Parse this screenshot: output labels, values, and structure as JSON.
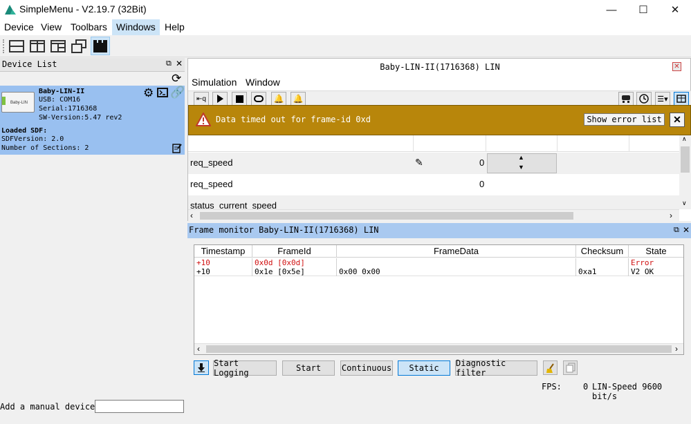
{
  "window": {
    "title": "SimpleMenu - V2.19.7 (32Bit)",
    "minimize": "—",
    "maximize": "☐",
    "close": "✕"
  },
  "menubar": [
    "Device",
    "View",
    "Toolbars",
    "Windows",
    "Help"
  ],
  "device_panel": {
    "title": "Device List",
    "device": {
      "name": "Baby-LIN-II",
      "usb": "USB: COM16",
      "serial": "Serial:1716368",
      "sw_version": "SW-Version:5.47 rev2",
      "image_label": "Baby-LIN"
    },
    "loaded_sdf_label": "Loaded SDF:",
    "sdf_version": "SDFVersion: 2.0",
    "sections": "Number of Sections: 2",
    "manual_device_label": "Add a manual device:",
    "manual_device_value": ""
  },
  "main_window": {
    "title": "Baby-LIN-II(1716368) LIN",
    "menus": [
      "Simulation",
      "Window"
    ],
    "error": {
      "message": "Data timed out for frame-id 0xd",
      "show_list_label": "Show error list",
      "close": "✕"
    },
    "signals": [
      {
        "name": "req_speed",
        "value": "0",
        "editable": true
      },
      {
        "name": "req_speed",
        "value": "0",
        "editable": false
      },
      {
        "name": "status_current_speed",
        "value": "",
        "editable": false
      }
    ]
  },
  "frame_monitor": {
    "title": "Frame monitor Baby-LIN-II(1716368) LIN",
    "columns": [
      "Timestamp",
      "FrameId",
      "FrameData",
      "Checksum",
      "State"
    ],
    "rows": [
      {
        "timestamp": "+10",
        "frame_id": "0x0d [0x0d]",
        "frame_data": "",
        "checksum": "",
        "state": "Error",
        "error": true
      },
      {
        "timestamp": "+10",
        "frame_id": "0x1e [0x5e]",
        "frame_data": "0x00 0x00",
        "checksum": "0xa1",
        "state": "V2 OK",
        "error": false
      }
    ],
    "buttons": {
      "start_logging": "Start Logging",
      "start": "Start",
      "continuous": "Continuous",
      "static": "Static",
      "diagnostic_filter": "Diagnostic filter"
    },
    "fps_label": "FPS:",
    "fps_value": "0",
    "lin_speed": "LIN-Speed 9600 bit/s"
  },
  "colors": {
    "selection": "#99c0f0",
    "error_bar": "#b8860b",
    "error_text": "#d01010",
    "menu_active": "#cce4f7"
  }
}
